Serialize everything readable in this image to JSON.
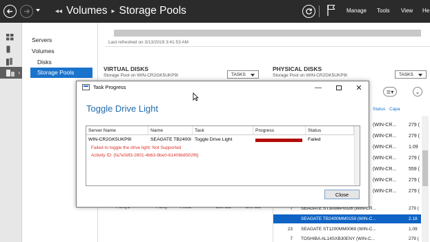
{
  "header": {
    "breadcrumb": [
      "Volumes",
      "Storage Pools"
    ],
    "menu": [
      "Manage",
      "Tools",
      "View",
      "He"
    ]
  },
  "rail": {
    "icons": [
      "dashboard-icon",
      "local-server-icon",
      "all-servers-icon",
      "file-storage-icon"
    ],
    "active_index": 3
  },
  "sidebar": {
    "items": [
      "Servers",
      "Volumes",
      "Disks",
      "Storage Pools"
    ],
    "active": "Storage Pools"
  },
  "storage_pools": {
    "last_refreshed": "Last refreshed on 3/13/2019 3:41:53 AM"
  },
  "virtual_disks": {
    "title": "VIRTUAL DISKS",
    "subtitle": "Storage Pool on WIN-CR2GK5UKP9I",
    "tasks_label": "TASKS",
    "bottom_row": [
      "Parity1",
      "Parity",
      "Fixed",
      "200 GB",
      "200 GB"
    ]
  },
  "physical_disks": {
    "title": "PHYSICAL DISKS",
    "subtitle": "Storage Pool on WIN-CR2GK5UKP9I",
    "tasks_label": "TASKS",
    "headers": [
      "Status",
      "Capa"
    ],
    "partial_rows": [
      {
        "name": "(WIN-CR...",
        "cap": "279 ("
      },
      {
        "name": "(WIN-CR...",
        "cap": "279 ("
      },
      {
        "name": "(WIN-CR...",
        "cap": "1.09"
      },
      {
        "name": "(WIN-CR...",
        "cap": "279 ("
      },
      {
        "name": "(WIN-CR...",
        "cap": "559 ("
      },
      {
        "name": "(WIN-CR...",
        "cap": "279 ("
      },
      {
        "name": "(WIN-CR...",
        "cap": "279 ("
      }
    ],
    "rows": [
      {
        "num": "7",
        "name": "SEAGATE ST300MP0026 (WIN-CR...",
        "cap": "279 (",
        "selected": false
      },
      {
        "num": "",
        "name": "SEAGATE TB2400MM0159 (WIN-C...",
        "cap": "2.18",
        "selected": true
      },
      {
        "num": "23",
        "name": "SEAGATE ST1200MM0069 (WIN-C...",
        "cap": "1.09",
        "selected": false
      },
      {
        "num": "7",
        "name": "TOSHIBA AL14SXB30ENY (WIN-C...",
        "cap": "279 (",
        "selected": false
      }
    ]
  },
  "dialog": {
    "title": "Task Progress",
    "heading": "Toggle Drive Light",
    "columns": [
      "Server Name",
      "Name",
      "Task",
      "Progress",
      "Status"
    ],
    "row": {
      "server": "WIN-CR2GK5UKP9I",
      "name": "SEAGATE TB2400I",
      "task": "Toggle Drive Light",
      "progress_fraction": 1.0,
      "status": "Failed"
    },
    "error_line1": "Failed to toggle the drive light: Not Supported",
    "error_line2": "Activity ID: {fa7e0df3-2801-4b63-8be0-61406b8502f6}",
    "close_label": "Close"
  },
  "colors": {
    "accent": "#1a73cc",
    "heading": "#1f6bab",
    "error": "#d9332b",
    "progress_failed": "#b30c0c",
    "topbar": "#2b2b2b"
  }
}
